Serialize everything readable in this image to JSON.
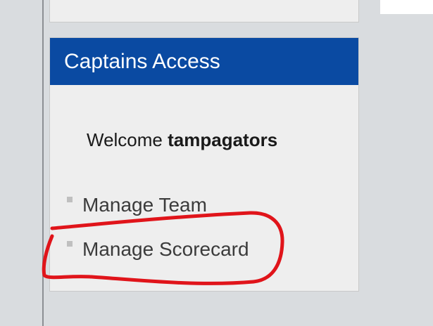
{
  "captains_panel": {
    "title": "Captains Access",
    "welcome_prefix": "Welcome ",
    "username": "tampagators",
    "menu": [
      {
        "label": "Manage Team"
      },
      {
        "label": "Manage Scorecard"
      }
    ]
  },
  "colors": {
    "header_bg": "#0a4aa2",
    "panel_bg": "#eeeeee",
    "page_bg": "#d9dcdf",
    "annotation": "#e0141a"
  }
}
